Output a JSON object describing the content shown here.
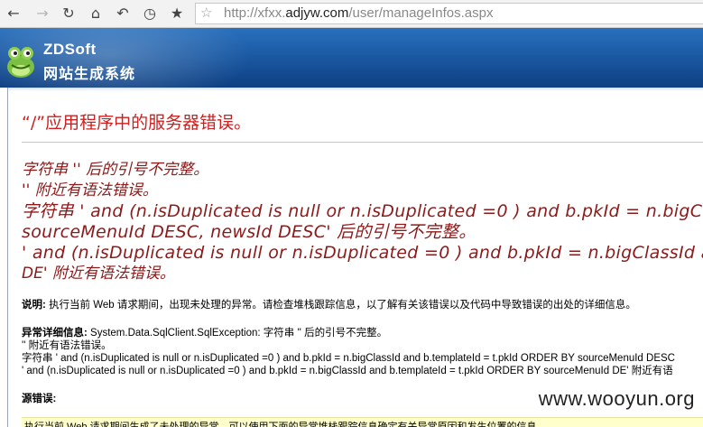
{
  "browser": {
    "url_prefix": "http://xfxx.",
    "url_host": "adjyw.com",
    "url_path": "/user/manageInfos.aspx"
  },
  "banner": {
    "logo_en": "ZDSoft",
    "logo_cn": "网站生成系统"
  },
  "error": {
    "title": "“/”应用程序中的服务器错误。",
    "lines": [
      "字符串 '' 后的引号不完整。",
      "'' 附近有语法错误。",
      "字符串 ' and (n.isDuplicated is null or n.isDuplicated =0 ) and b.pkId = n.bigClassId and b.templateId = t.pkId ORDER BY",
      "sourceMenuId DESC, newsId DESC' 后的引号不完整。",
      "' and (n.isDuplicated is null or n.isDuplicated =0 ) and b.pkId = n.bigClassId and b.templateId = t.pkId ORDER BY sourceMenuId",
      "DE' 附近有语法错误。"
    ]
  },
  "description": {
    "label": "说明:",
    "text": " 执行当前 Web 请求期间，出现未处理的异常。请检查堆栈跟踪信息，以了解有关该错误以及代码中导致错误的出处的详细信息。"
  },
  "exception": {
    "label": "异常详细信息:",
    "text": " System.Data.SqlClient.SqlException: 字符串 '' 后的引号不完整。",
    "lines": [
      "'' 附近有语法错误。",
      "字符串 ' and (n.isDuplicated is null or n.isDuplicated =0 ) and b.pkId = n.bigClassId and b.templateId = t.pkId ORDER BY sourceMenuId DESC",
      "' and (n.isDuplicated is null or n.isDuplicated =0 ) and b.pkId = n.bigClassId and b.templateId = t.pkId ORDER BY sourceMenuId DE' 附近有语"
    ]
  },
  "source": {
    "label": "源错误:",
    "bar_text": "执行当前 Web 请求期间生成了未处理的异常。可以使用下面的异常堆栈跟踪信息确定有关异常原因和发生位置的信息。"
  },
  "watermark": "www.wooyun.org",
  "icons": [
    "back-icon",
    "forward-icon",
    "reload-icon",
    "home-icon",
    "undo-icon",
    "history-icon",
    "bookmark-star-icon",
    "page-star-icon"
  ],
  "colors": {
    "error_title": "#cc1f1f",
    "error_msg": "#8b1a1a",
    "banner": "#1b5aa4",
    "source_bar": "#ffffcc"
  }
}
